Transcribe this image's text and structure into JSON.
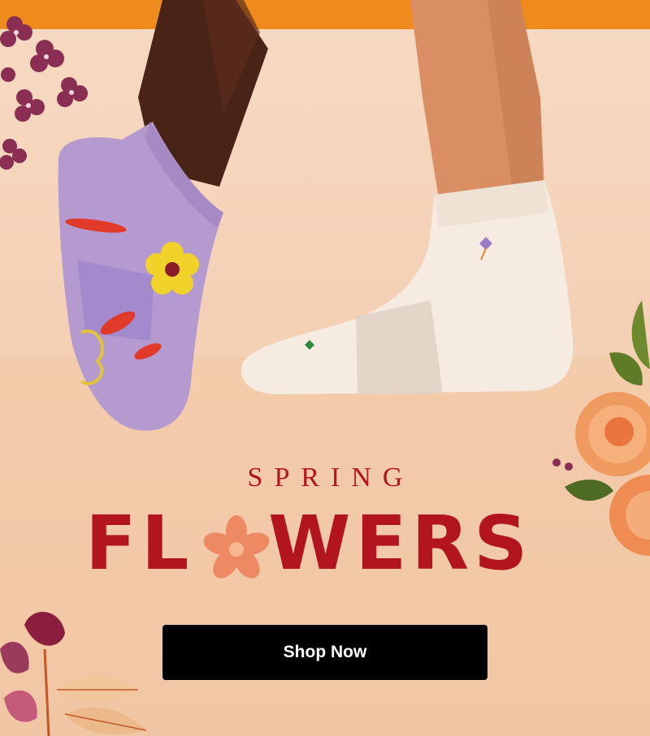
{
  "banner": {
    "kicker": "SPRING",
    "headline_left": "FL",
    "headline_right": "WERS",
    "cta_label": "Shop Now"
  },
  "colors": {
    "top_strip": "#ef8a1c",
    "headline": "#b3151f",
    "cta_background": "#000000",
    "cta_text": "#ffffff",
    "flower_o": "#ee8a63"
  },
  "icons": [
    "flower-o-icon",
    "purple-flowers-decoration",
    "orange-rose-decoration",
    "burgundy-tulips-decoration"
  ]
}
